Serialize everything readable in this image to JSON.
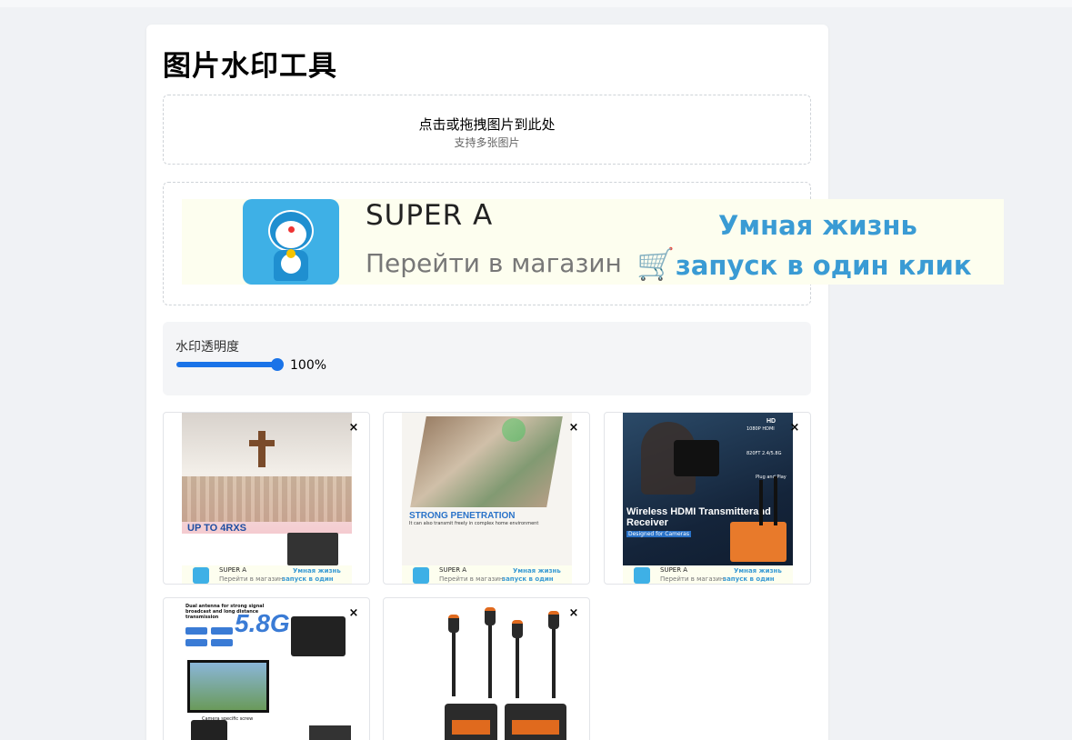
{
  "app": {
    "title": "图片水印工具"
  },
  "upload": {
    "main_text": "点击或拖拽图片到此处",
    "sub_text": "支持多张图片"
  },
  "watermark": {
    "brand": "SUPER A",
    "shop_link": "Перейти в магазин",
    "slogan_line1": "Умная жизнь",
    "slogan_line2": "запуск в один клик",
    "colors": {
      "background": "#fdfeef",
      "slogan": "#3a9bd4",
      "avatar": "#3eb0e6"
    }
  },
  "opacity": {
    "label": "水印透明度",
    "value_text": "100%",
    "value": 1.0
  },
  "images": [
    {
      "id": "img1",
      "close": "×",
      "caption_title": "UP TO 4RXS",
      "bg": "#e9e2dc"
    },
    {
      "id": "img2",
      "close": "×",
      "caption_title": "STRONG PENETRATION",
      "caption_sub": "It can also transmit freely in complex home environment",
      "bg": "#f4f1ec"
    },
    {
      "id": "img3",
      "close": "×",
      "caption_title": "Wireless HDMI Transmitterand Receiver",
      "caption_sub": "Designed for Cameras",
      "badge1": "HD",
      "badge2": "1080P HDMI",
      "badge3": "820FT 2.4/5.8G",
      "badge4": "Plug and Play",
      "bg": "#1d3348"
    },
    {
      "id": "img4",
      "close": "×",
      "caption_title": "5.8G",
      "caption_sub": "Dual antenna for strong signal broadcast and long distance transmission",
      "bg": "#ffffff"
    },
    {
      "id": "img5",
      "close": "×",
      "bg": "#ffffff"
    }
  ],
  "icons": {
    "close": "close-icon",
    "cart": "cart-icon"
  }
}
